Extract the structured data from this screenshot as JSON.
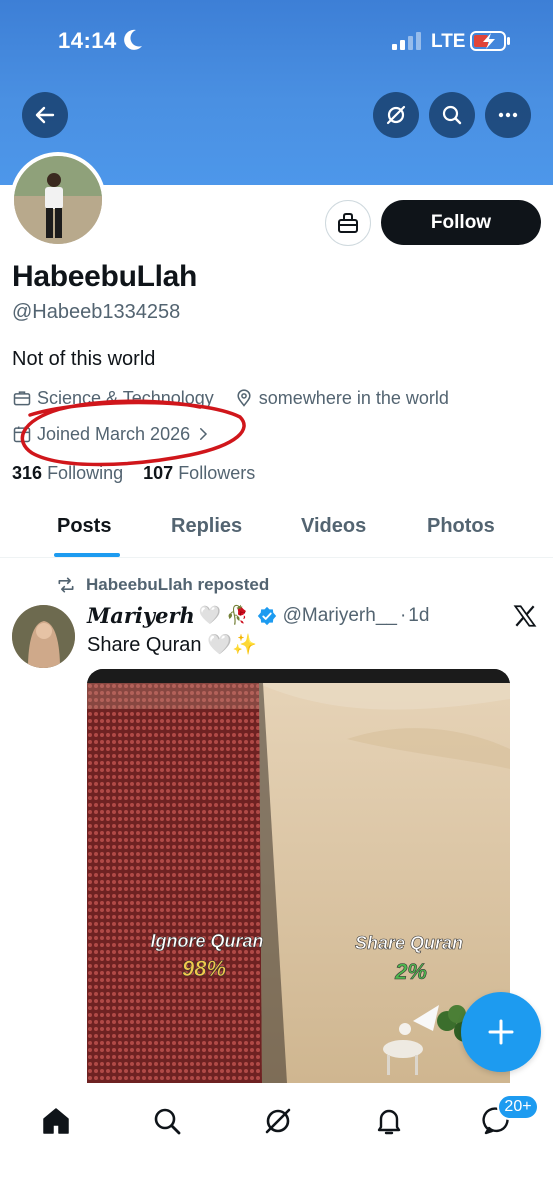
{
  "status_bar": {
    "time": "14:14",
    "network": "LTE",
    "icons": [
      "moon-icon",
      "signal-icon",
      "battery-charging-icon"
    ]
  },
  "header": {
    "buttons": [
      "back-arrow-icon",
      "grok-icon",
      "search-icon",
      "more-icon"
    ]
  },
  "profile": {
    "display_name": "HabeebuLlah",
    "handle": "@Habeeb1334258",
    "bio": "Not of this world",
    "category": "Science & Technology",
    "location": "somewhere in the world",
    "joined": "Joined March 2026",
    "following_count": "316",
    "following_label": "Following",
    "followers_count": "107",
    "followers_label": "Followers",
    "follow_button": "Follow"
  },
  "tabs": [
    {
      "label": "Posts",
      "active": true
    },
    {
      "label": "Replies",
      "active": false
    },
    {
      "label": "Videos",
      "active": false
    },
    {
      "label": "Photos",
      "active": false
    }
  ],
  "post": {
    "repost_label": "HabeebuLlah reposted",
    "author_name": "Mariyerh",
    "author_emoji": "🤍 🥀",
    "author_handle": "@Mariyerh__",
    "separator": "·",
    "time": "1d",
    "text": "Share Quran",
    "text_emoji": "🤍✨",
    "media": {
      "left_caption": "Ignore Quran",
      "left_percent": "98%",
      "right_caption": "Share Quran",
      "right_percent": "2%"
    }
  },
  "fab": {
    "icon": "plus-icon"
  },
  "bottom_nav": {
    "items": [
      "home-icon",
      "search-icon",
      "grok-icon",
      "notifications-icon",
      "messages-icon"
    ],
    "messages_badge": "20+"
  },
  "colors": {
    "accent": "#1d9bf0",
    "banner": "#4a90e2",
    "annotation": "#d0161b"
  }
}
